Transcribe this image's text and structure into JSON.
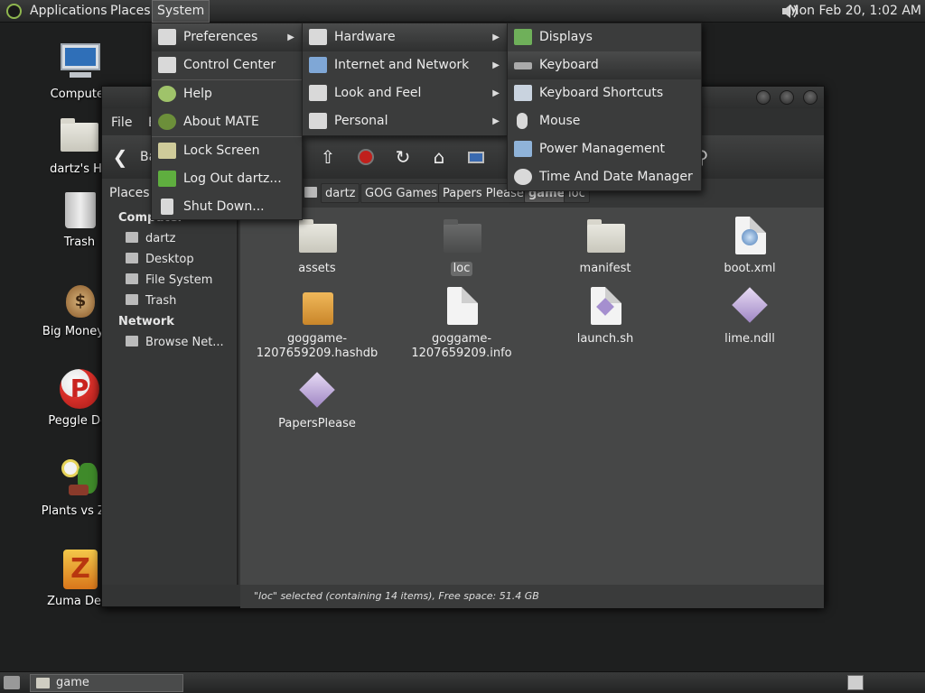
{
  "top_panel": {
    "applications": "Applications",
    "places": "Places",
    "system": "System",
    "clock": "Mon Feb 20,  1:02 AM"
  },
  "desktop": {
    "icons": [
      {
        "label": "Computer",
        "icon": "computer-icon"
      },
      {
        "label": "dartz's Ho",
        "icon": "home-folder-icon"
      },
      {
        "label": "Trash",
        "icon": "trash-icon"
      },
      {
        "label": "Big Money D",
        "icon": "money-bag-icon"
      },
      {
        "label": "Peggle Del",
        "icon": "peggle-icon"
      },
      {
        "label": "Plants vs Zor",
        "icon": "plants-icon"
      },
      {
        "label": "Zuma Delu",
        "icon": "zuma-icon"
      }
    ]
  },
  "system_menu": {
    "items": [
      {
        "label": "Preferences",
        "icon": "preferences-icon",
        "submenu": true
      },
      {
        "label": "Control Center",
        "icon": "control-center-icon"
      },
      {
        "label": "Help",
        "icon": "help-icon"
      },
      {
        "label": "About MATE",
        "icon": "about-icon"
      },
      {
        "label": "Lock Screen",
        "icon": "lock-icon"
      },
      {
        "label": "Log Out dartz...",
        "icon": "logout-icon"
      },
      {
        "label": "Shut Down...",
        "icon": "shutdown-icon"
      }
    ]
  },
  "preferences_menu": {
    "items": [
      {
        "label": "Hardware",
        "icon": "hardware-icon",
        "submenu": true
      },
      {
        "label": "Internet and Network",
        "icon": "network-icon",
        "submenu": true
      },
      {
        "label": "Look and Feel",
        "icon": "look-feel-icon",
        "submenu": true
      },
      {
        "label": "Personal",
        "icon": "personal-icon",
        "submenu": true
      }
    ]
  },
  "hardware_menu": {
    "items": [
      {
        "label": "Displays",
        "icon": "display-icon"
      },
      {
        "label": "Keyboard",
        "icon": "keyboard-icon",
        "highlighted": true
      },
      {
        "label": "Keyboard Shortcuts",
        "icon": "shortcuts-icon"
      },
      {
        "label": "Mouse",
        "icon": "mouse-icon"
      },
      {
        "label": "Power Management",
        "icon": "power-icon"
      },
      {
        "label": "Time And Date Manager",
        "icon": "clock-icon"
      }
    ]
  },
  "file_manager": {
    "menubar": {
      "file": "File",
      "edit": "E"
    },
    "toolbar": {
      "back": "Ba"
    },
    "places_label": "Places",
    "breadcrumbs": [
      "dartz",
      "GOG Games",
      "Papers Please",
      "game",
      "loc"
    ],
    "sidebar": {
      "computer_heading": "Computer",
      "computer_items": [
        "dartz",
        "Desktop",
        "File System",
        "Trash"
      ],
      "network_heading": "Network",
      "network_items": [
        "Browse Net..."
      ]
    },
    "files": [
      {
        "name": "assets",
        "type": "folder"
      },
      {
        "name": "loc",
        "type": "folder-selected"
      },
      {
        "name": "manifest",
        "type": "folder"
      },
      {
        "name": "boot.xml",
        "type": "xml"
      },
      {
        "name": "goggame-1207659209.hashdb",
        "type": "package"
      },
      {
        "name": "goggame-1207659209.info",
        "type": "text"
      },
      {
        "name": "launch.sh",
        "type": "script"
      },
      {
        "name": "lime.ndll",
        "type": "library"
      },
      {
        "name": "PapersPlease",
        "type": "executable"
      }
    ],
    "status": "\"loc\" selected (containing 14 items), Free space: 51.4 GB"
  },
  "bottom_panel": {
    "task": "game"
  }
}
